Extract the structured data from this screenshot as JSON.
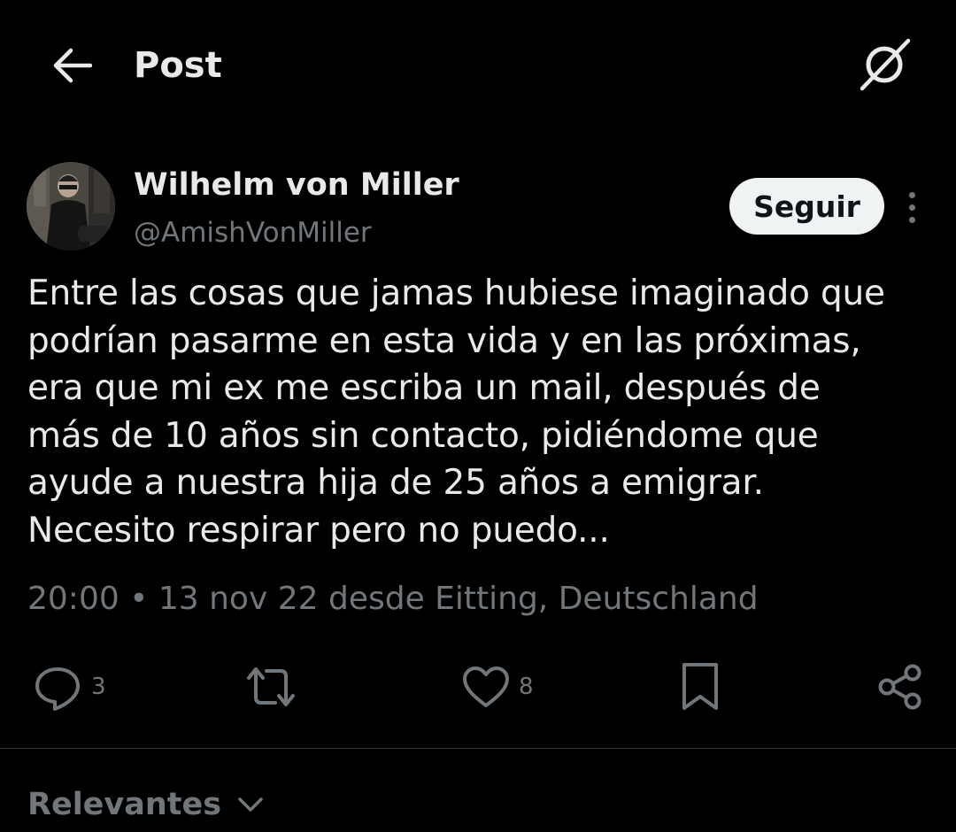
{
  "header": {
    "title": "Post",
    "back_icon": "arrow-left-icon",
    "grok_icon": "grok-icon"
  },
  "author": {
    "name": "Wilhelm von Miller",
    "handle": "@AmishVonMiller",
    "follow_label": "Seguir"
  },
  "tweet": {
    "text": "Entre las cosas que jamas hubiese imaginado que\npodrían pasarme en esta vida y en las próximas,\nera que mi ex me escriba un mail, después de\nmás de 10 años sin contacto, pidiéndome que\nayude a nuestra hija de 25 años a emigrar.\nNecesito respirar pero no puedo...",
    "meta": "20:00 • 13 nov 22 desde Eitting, Deutschland"
  },
  "actions": {
    "replies": "3",
    "likes": "8"
  },
  "replies_filter": {
    "label": "Relevantes"
  },
  "colors": {
    "background": "#000000",
    "text_primary": "#e7e9ea",
    "text_secondary": "#71767b",
    "button_bg": "#eff3f4"
  }
}
